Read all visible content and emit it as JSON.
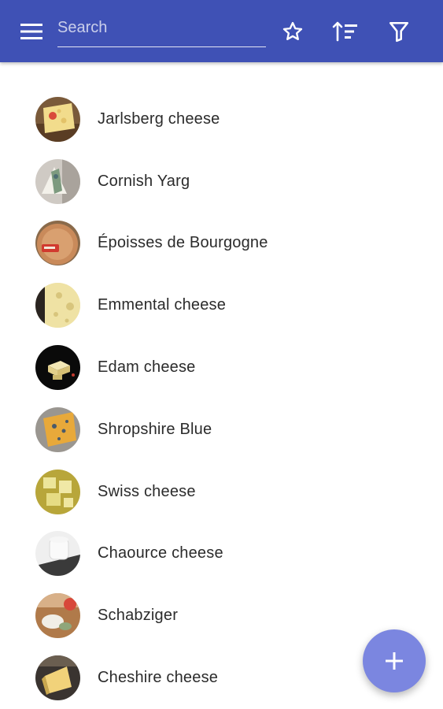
{
  "appbar": {
    "search_placeholder": "Search",
    "search_value": "",
    "menu_icon": "menu-icon",
    "favorite_icon": "star-outline-icon",
    "sort_icon": "sort-icon",
    "filter_icon": "filter-icon",
    "color": "#3f51b5"
  },
  "items": [
    {
      "label": "Jarlsberg cheese",
      "icon": "jarlsberg-thumbnail"
    },
    {
      "label": "Cornish Yarg",
      "icon": "cornish-yarg-thumbnail"
    },
    {
      "label": "Époisses de Bourgogne",
      "icon": "epoisses-thumbnail"
    },
    {
      "label": "Emmental cheese",
      "icon": "emmental-thumbnail"
    },
    {
      "label": "Edam cheese",
      "icon": "edam-thumbnail"
    },
    {
      "label": "Shropshire Blue",
      "icon": "shropshire-blue-thumbnail"
    },
    {
      "label": "Swiss cheese",
      "icon": "swiss-cheese-thumbnail"
    },
    {
      "label": "Chaource cheese",
      "icon": "chaource-thumbnail"
    },
    {
      "label": "Schabziger",
      "icon": "schabziger-thumbnail"
    },
    {
      "label": "Cheshire cheese",
      "icon": "cheshire-thumbnail"
    }
  ],
  "fab": {
    "icon": "plus-icon",
    "color": "#7b86e0"
  }
}
